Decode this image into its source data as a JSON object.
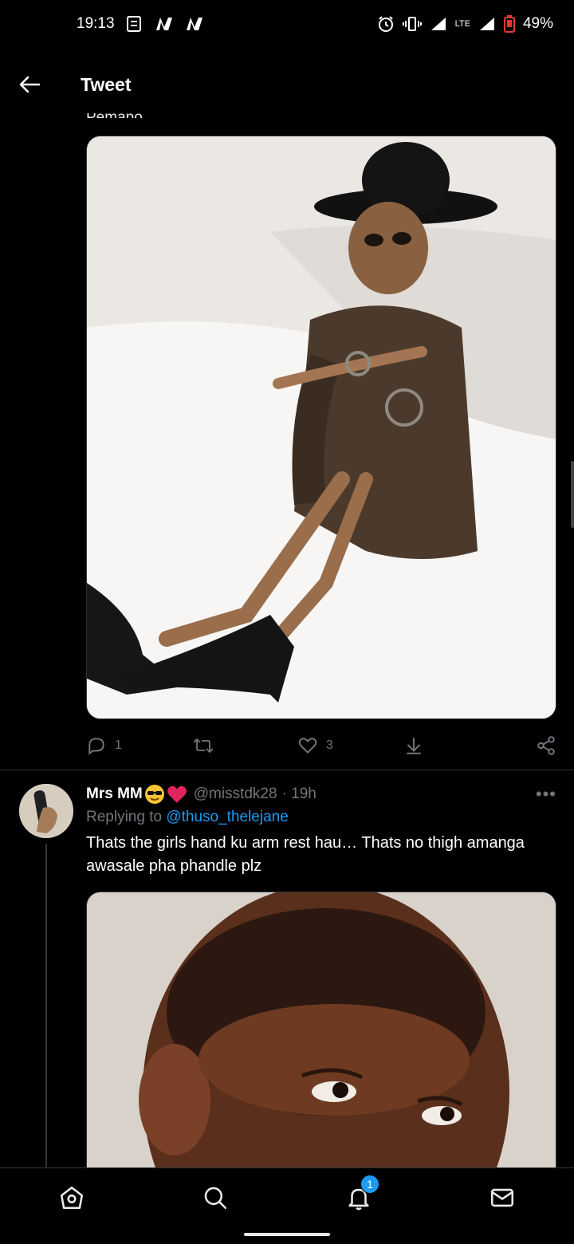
{
  "status_bar": {
    "time": "19:13",
    "network": "LTE",
    "battery": "49%"
  },
  "header": {
    "title": "Tweet"
  },
  "clipped_text": "Pemapo",
  "tweet_actions": {
    "replies": "1",
    "likes": "3"
  },
  "reply": {
    "display_name": "Mrs MM",
    "handle": "@misstdk28",
    "time": "· 19h",
    "more": "•••",
    "replying_prefix": "Replying to ",
    "replying_to": "@thuso_thelejane",
    "text": "Thats the girls hand ku arm rest hau… Thats no thigh amanga awasale pha phandle plz"
  },
  "bottom_nav": {
    "notification_badge": "1"
  },
  "colors": {
    "accent": "#1d9bf0",
    "background": "#000000",
    "muted": "#71767b",
    "heart": "#e0245e"
  }
}
